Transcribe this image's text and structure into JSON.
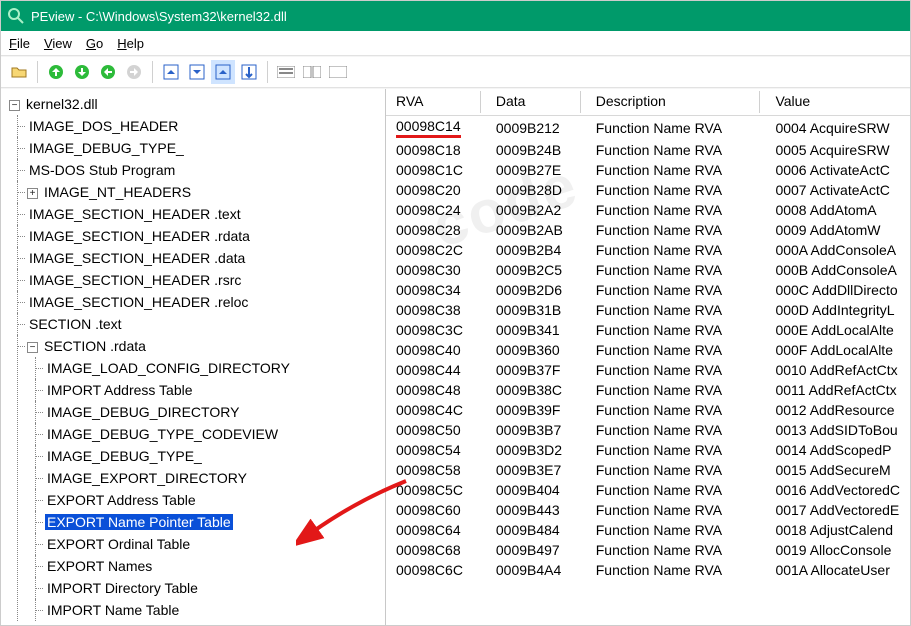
{
  "title": "PEview - C:\\Windows\\System32\\kernel32.dll",
  "menu": {
    "file": "File",
    "view": "View",
    "go": "Go",
    "help": "Help"
  },
  "tree": {
    "root": "kernel32.dll",
    "children": [
      "IMAGE_DOS_HEADER",
      "IMAGE_DEBUG_TYPE_",
      "MS-DOS Stub Program",
      "IMAGE_NT_HEADERS",
      "IMAGE_SECTION_HEADER .text",
      "IMAGE_SECTION_HEADER .rdata",
      "IMAGE_SECTION_HEADER .data",
      "IMAGE_SECTION_HEADER .rsrc",
      "IMAGE_SECTION_HEADER .reloc",
      "SECTION .text",
      "SECTION .rdata"
    ],
    "rdata_children": [
      "IMAGE_LOAD_CONFIG_DIRECTORY",
      "IMPORT Address Table",
      "IMAGE_DEBUG_DIRECTORY",
      "IMAGE_DEBUG_TYPE_CODEVIEW",
      "IMAGE_DEBUG_TYPE_",
      "IMAGE_EXPORT_DIRECTORY",
      "EXPORT Address Table",
      "EXPORT Name Pointer Table",
      "EXPORT Ordinal Table",
      "EXPORT Names",
      "IMPORT Directory Table",
      "IMPORT Name Table"
    ],
    "selected": "EXPORT Name Pointer Table"
  },
  "table": {
    "headers": {
      "rva": "RVA",
      "data": "Data",
      "desc": "Description",
      "value": "Value"
    },
    "rows": [
      {
        "rva": "00098C14",
        "data": "0009B212",
        "desc": "Function Name RVA",
        "value": "0004  AcquireSRW"
      },
      {
        "rva": "00098C18",
        "data": "0009B24B",
        "desc": "Function Name RVA",
        "value": "0005  AcquireSRW"
      },
      {
        "rva": "00098C1C",
        "data": "0009B27E",
        "desc": "Function Name RVA",
        "value": "0006  ActivateActC"
      },
      {
        "rva": "00098C20",
        "data": "0009B28D",
        "desc": "Function Name RVA",
        "value": "0007  ActivateActC"
      },
      {
        "rva": "00098C24",
        "data": "0009B2A2",
        "desc": "Function Name RVA",
        "value": "0008  AddAtomA"
      },
      {
        "rva": "00098C28",
        "data": "0009B2AB",
        "desc": "Function Name RVA",
        "value": "0009  AddAtomW"
      },
      {
        "rva": "00098C2C",
        "data": "0009B2B4",
        "desc": "Function Name RVA",
        "value": "000A  AddConsoleA"
      },
      {
        "rva": "00098C30",
        "data": "0009B2C5",
        "desc": "Function Name RVA",
        "value": "000B  AddConsoleA"
      },
      {
        "rva": "00098C34",
        "data": "0009B2D6",
        "desc": "Function Name RVA",
        "value": "000C  AddDllDirecto"
      },
      {
        "rva": "00098C38",
        "data": "0009B31B",
        "desc": "Function Name RVA",
        "value": "000D  AddIntegrityL"
      },
      {
        "rva": "00098C3C",
        "data": "0009B341",
        "desc": "Function Name RVA",
        "value": "000E  AddLocalAlte"
      },
      {
        "rva": "00098C40",
        "data": "0009B360",
        "desc": "Function Name RVA",
        "value": "000F  AddLocalAlte"
      },
      {
        "rva": "00098C44",
        "data": "0009B37F",
        "desc": "Function Name RVA",
        "value": "0010  AddRefActCtx"
      },
      {
        "rva": "00098C48",
        "data": "0009B38C",
        "desc": "Function Name RVA",
        "value": "0011  AddRefActCtx"
      },
      {
        "rva": "00098C4C",
        "data": "0009B39F",
        "desc": "Function Name RVA",
        "value": "0012  AddResource"
      },
      {
        "rva": "00098C50",
        "data": "0009B3B7",
        "desc": "Function Name RVA",
        "value": "0013  AddSIDToBou"
      },
      {
        "rva": "00098C54",
        "data": "0009B3D2",
        "desc": "Function Name RVA",
        "value": "0014  AddScopedP"
      },
      {
        "rva": "00098C58",
        "data": "0009B3E7",
        "desc": "Function Name RVA",
        "value": "0015  AddSecureM"
      },
      {
        "rva": "00098C5C",
        "data": "0009B404",
        "desc": "Function Name RVA",
        "value": "0016  AddVectoredC"
      },
      {
        "rva": "00098C60",
        "data": "0009B443",
        "desc": "Function Name RVA",
        "value": "0017  AddVectoredE"
      },
      {
        "rva": "00098C64",
        "data": "0009B484",
        "desc": "Function Name RVA",
        "value": "0018  AdjustCalend"
      },
      {
        "rva": "00098C68",
        "data": "0009B497",
        "desc": "Function Name RVA",
        "value": "0019  AllocConsole"
      },
      {
        "rva": "00098C6C",
        "data": "0009B4A4",
        "desc": "Function Name RVA",
        "value": "001A  AllocateUser"
      }
    ]
  }
}
